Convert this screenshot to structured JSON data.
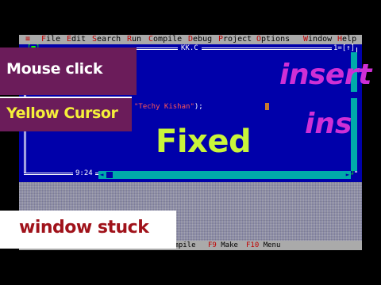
{
  "menubar": {
    "system_icon": "≡",
    "items": [
      {
        "hot": "F",
        "rest": "ile"
      },
      {
        "hot": "E",
        "rest": "dit"
      },
      {
        "hot": "S",
        "rest": "earch"
      },
      {
        "hot": "R",
        "rest": "un"
      },
      {
        "hot": "C",
        "rest": "ompile"
      },
      {
        "hot": "D",
        "rest": "ebug"
      },
      {
        "hot": "P",
        "rest": "roject"
      },
      {
        "hot": "O",
        "rest": "ptions"
      },
      {
        "hot": "W",
        "rest": "indow"
      },
      {
        "hot": "H",
        "rest": "elp"
      }
    ]
  },
  "editor": {
    "filename": "KK.C",
    "window_number": "1=[↑]",
    "close_box": "[■]",
    "code_line_string": "\"Techy Kishan\"",
    "code_line_tail": ");",
    "line_col": "9:24",
    "scroll_left_arrow": "◄",
    "scroll_right_arrow": "►",
    "resize_handle": "┘"
  },
  "statusbar": {
    "partial_item": "ompile",
    "items": [
      {
        "key": "F9",
        "label": "Make"
      },
      {
        "key": "F10",
        "label": "Menu"
      }
    ]
  },
  "overlay": {
    "mouse_click": "Mouse click",
    "yellow_cursor": "Yellow Cursor",
    "insert": "insert",
    "ins": "ins",
    "fixed": "Fixed",
    "window_stuck": "window stuck"
  },
  "colors": {
    "editor_background": "#0000aa",
    "menubar_background": "#aaaaaa",
    "hotkey": "#c00000",
    "label_box": "#6b1c5a",
    "yellow": "#f5ef3a",
    "magenta": "#cf2fd6",
    "lime": "#c9f53a",
    "stuck_red": "#a0121a"
  }
}
